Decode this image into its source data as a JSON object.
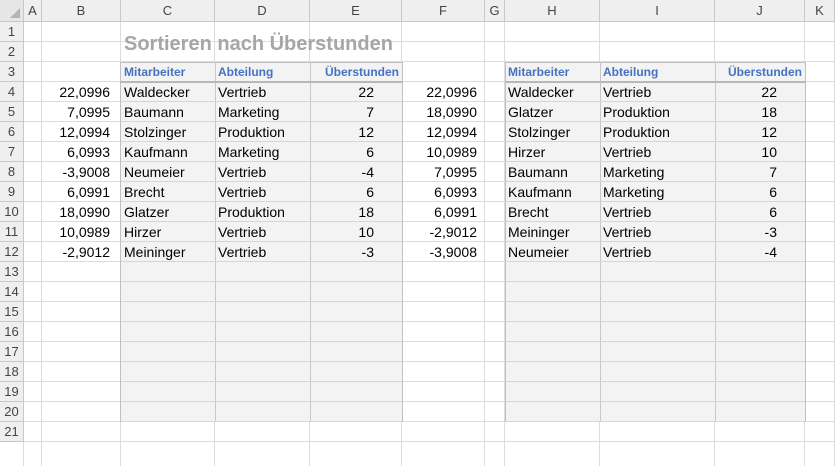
{
  "columns": [
    "A",
    "B",
    "C",
    "D",
    "E",
    "F",
    "G",
    "H",
    "I",
    "J",
    "K"
  ],
  "rows": [
    "1",
    "2",
    "3",
    "4",
    "5",
    "6",
    "7",
    "8",
    "9",
    "10",
    "11",
    "12",
    "13",
    "14",
    "15",
    "16",
    "17",
    "18",
    "19",
    "20",
    "21"
  ],
  "title": "Sortieren nach Überstunden",
  "headers": {
    "mitarbeiter": "Mitarbeiter",
    "abteilung": "Abteilung",
    "ueberstunden": "Überstunden"
  },
  "col_b": [
    "22,0996",
    "7,0995",
    "12,0994",
    "6,0993",
    "-3,9008",
    "6,0991",
    "18,0990",
    "10,0989",
    "-2,9012"
  ],
  "left_table": [
    {
      "name": "Waldecker",
      "dept": "Vertrieb",
      "hours": "22"
    },
    {
      "name": "Baumann",
      "dept": "Marketing",
      "hours": "7"
    },
    {
      "name": "Stolzinger",
      "dept": "Produktion",
      "hours": "12"
    },
    {
      "name": "Kaufmann",
      "dept": "Marketing",
      "hours": "6"
    },
    {
      "name": "Neumeier",
      "dept": "Vertrieb",
      "hours": "-4"
    },
    {
      "name": "Brecht",
      "dept": "Vertrieb",
      "hours": "6"
    },
    {
      "name": "Glatzer",
      "dept": "Produktion",
      "hours": "18"
    },
    {
      "name": "Hirzer",
      "dept": "Vertrieb",
      "hours": "10"
    },
    {
      "name": "Meininger",
      "dept": "Vertrieb",
      "hours": "-3"
    }
  ],
  "col_f": [
    "22,0996",
    "18,0990",
    "12,0994",
    "10,0989",
    "7,0995",
    "6,0993",
    "6,0991",
    "-2,9012",
    "-3,9008"
  ],
  "right_table": [
    {
      "name": "Waldecker",
      "dept": "Vertrieb",
      "hours": "22"
    },
    {
      "name": "Glatzer",
      "dept": "Produktion",
      "hours": "18"
    },
    {
      "name": "Stolzinger",
      "dept": "Produktion",
      "hours": "12"
    },
    {
      "name": "Hirzer",
      "dept": "Vertrieb",
      "hours": "10"
    },
    {
      "name": "Baumann",
      "dept": "Marketing",
      "hours": "7"
    },
    {
      "name": "Kaufmann",
      "dept": "Marketing",
      "hours": "6"
    },
    {
      "name": "Brecht",
      "dept": "Vertrieb",
      "hours": "6"
    },
    {
      "name": "Meininger",
      "dept": "Vertrieb",
      "hours": "-3"
    },
    {
      "name": "Neumeier",
      "dept": "Vertrieb",
      "hours": "-4"
    }
  ],
  "colors": {
    "title": "#a6a6a6",
    "header_text": "#4472c4",
    "table_fill": "#f3f3f3"
  }
}
